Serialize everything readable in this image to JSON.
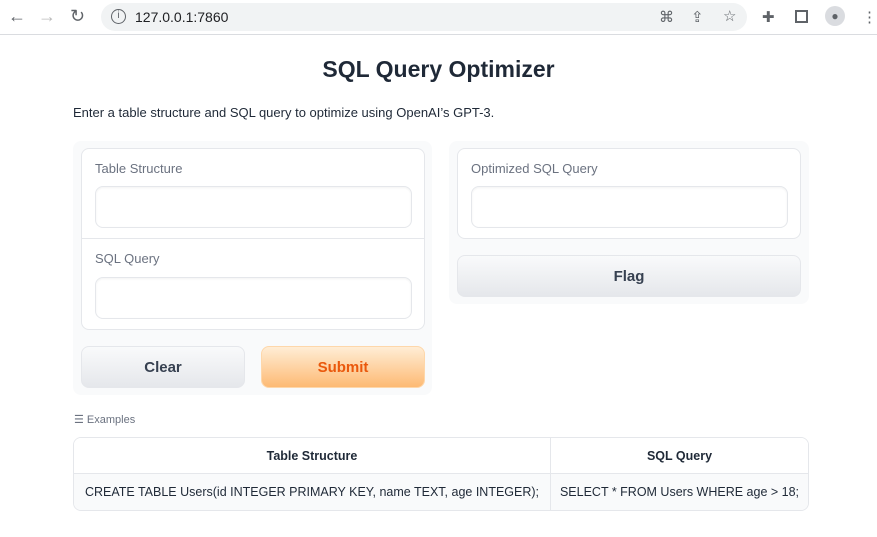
{
  "browser": {
    "url": "127.0.0.1:7860",
    "icons": [
      "back-icon",
      "forward-icon",
      "reload-icon",
      "info-icon",
      "translate-icon",
      "share-icon",
      "star-icon",
      "extensions-icon",
      "sidepanel-icon",
      "profile-icon",
      "menu-icon"
    ]
  },
  "page": {
    "title": "SQL Query Optimizer",
    "description": "Enter a table structure and SQL query to optimize using OpenAI’s GPT-3."
  },
  "inputs": {
    "table_structure_label": "Table Structure",
    "table_structure_value": "",
    "sql_query_label": "SQL Query",
    "sql_query_value": ""
  },
  "output": {
    "label": "Optimized SQL Query",
    "value": ""
  },
  "buttons": {
    "clear": "Clear",
    "submit": "Submit",
    "flag": "Flag"
  },
  "examples": {
    "label": "Examples",
    "headers": [
      "Table Structure",
      "SQL Query"
    ],
    "rows": [
      [
        "CREATE TABLE Users(id INTEGER PRIMARY KEY, name TEXT, age INTEGER);",
        "SELECT * FROM Users WHERE age > 18;"
      ]
    ]
  },
  "colors": {
    "accent": "#ea580c",
    "submit_bg": "#fdba74"
  }
}
